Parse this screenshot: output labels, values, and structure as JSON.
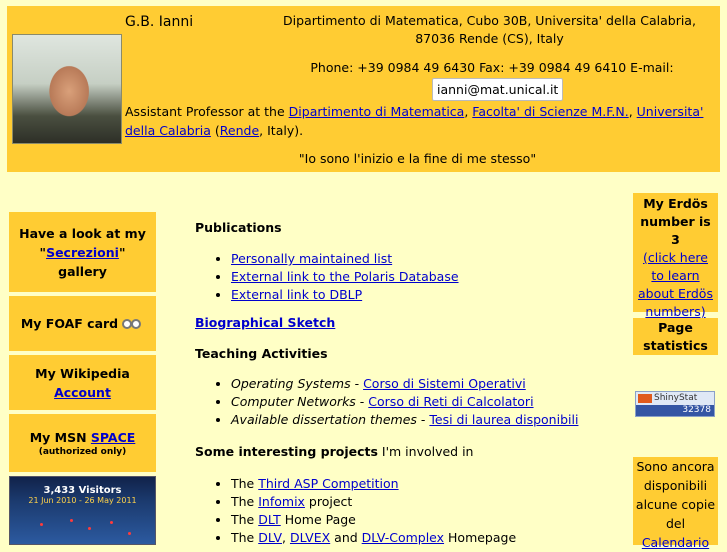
{
  "header": {
    "name": "G.B. Ianni",
    "address": "Dipartimento di Matematica, Cubo 30B, Universita' della Calabria, 87036 Rende (CS), Italy",
    "phone": "Phone: +39 0984 49 6430 Fax: +39 0984 49 6410 E-mail:",
    "email": "ianni@mat.unical.it",
    "position": {
      "prefix": "Assistant Professor at the ",
      "dept": "Dipartimento di Matematica",
      "sep1": ", ",
      "faculty": "Facolta' di Scienze M.F.N.",
      "sep2": ", ",
      "university": "Universita' della Calabria",
      "sep3": " (",
      "city": "Rende",
      "suffix": ", Italy)."
    },
    "quote": "\"Io sono l'inizio e la fine di me stesso\""
  },
  "left": {
    "secrezioni": {
      "pre": "Have a look at my",
      "q1": "\"",
      "link": "Secrezioni",
      "q2": "\"",
      "post": "gallery"
    },
    "foaf": "My FOAF card",
    "wikipedia": {
      "pre": "My Wikipedia",
      "link": "Account"
    },
    "msn": {
      "pre": "My MSN",
      "link": "SPACE",
      "note": "(authorized only)"
    },
    "visitors": {
      "count": "3,433 Visitors",
      "dates": "21 Jun 2010 - 26 May 2011"
    }
  },
  "main": {
    "publications": {
      "title": "Publications",
      "items": [
        "Personally maintained list",
        "External link to the Polaris Database",
        "External link to DBLP"
      ]
    },
    "bio": "Biographical Sketch",
    "teaching": {
      "title": "Teaching Activities",
      "items": [
        {
          "topic": "Operating Systems",
          "sep": " - ",
          "link": "Corso di Sistemi Operativi"
        },
        {
          "topic": "Computer Networks",
          "sep": " - ",
          "link": "Corso di Reti di Calcolatori"
        },
        {
          "topic": "Available dissertation themes",
          "sep": " - ",
          "link": "Tesi di laurea disponibili"
        }
      ]
    },
    "projects": {
      "title": "Some interesting projects",
      "title_suffix": " I'm involved in",
      "items": [
        {
          "pre": "The ",
          "link": "Third ASP Competition",
          "post": ""
        },
        {
          "pre": "The ",
          "link": "Infomix",
          "post": " project"
        },
        {
          "pre": "The ",
          "link": "DLT",
          "post": " Home Page"
        },
        {
          "pre": "The ",
          "link": "DLV",
          "sep1": ", ",
          "link2": "DLVEX",
          "sep2": " and ",
          "link3": "DLV-Complex",
          "post": " Homepage"
        }
      ]
    }
  },
  "right": {
    "erdos": {
      "title": "My Erdös number is 3",
      "link": "(click here to learn about Erdös numbers)"
    },
    "stats": "Page statistics",
    "shinystat": {
      "brand": "ShinyStat",
      "count": "32378"
    },
    "calendar": {
      "text": "Sono ancora disponibili alcune copie del",
      "link": "Calendario"
    }
  }
}
